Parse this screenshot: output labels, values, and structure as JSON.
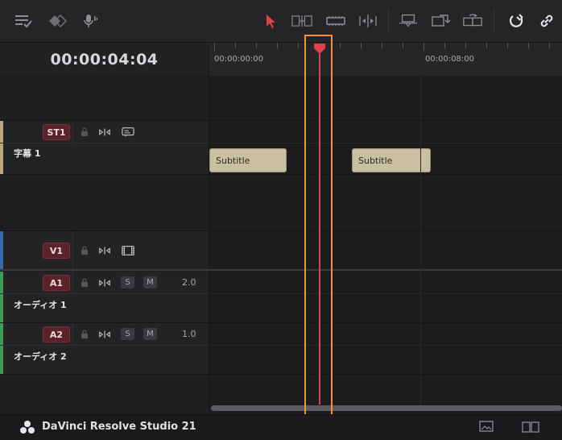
{
  "toolbar": {
    "left_icons": [
      "timeline-options-icon",
      "flags-icon",
      "voiceover-mic-icon"
    ],
    "center_icons": [
      "selection-arrow-icon",
      "trim-edit-icon",
      "blade-edit-icon",
      "dynamic-trim-icon",
      "overwrite-clip-icon",
      "replace-clip-icon",
      "place-on-top-icon"
    ],
    "right_icons": [
      "snapping-icon",
      "linked-selection-icon"
    ],
    "accent": "#e0404a"
  },
  "timecode": "00:00:04:04",
  "ruler": {
    "labels": [
      "00:00:00:00",
      "00:00:08:00"
    ]
  },
  "tracks": {
    "st1": {
      "badge": "ST1",
      "name": "字幕 1",
      "color": "#b9a77a"
    },
    "v1": {
      "badge": "V1",
      "color": "#3b6aa8"
    },
    "a1": {
      "badge": "A1",
      "name": "オーディオ 1",
      "volume": "2.0",
      "solo": "S",
      "mute": "M",
      "color": "#3f9a57"
    },
    "a2": {
      "badge": "A2",
      "name": "オーディオ 2",
      "volume": "1.0",
      "solo": "S",
      "mute": "M",
      "color": "#3f9a57"
    }
  },
  "clips": [
    {
      "label": "Subtitle"
    },
    {
      "label": "Subtitle"
    }
  ],
  "footer": {
    "brand": "DaVinci Resolve Studio 21"
  }
}
